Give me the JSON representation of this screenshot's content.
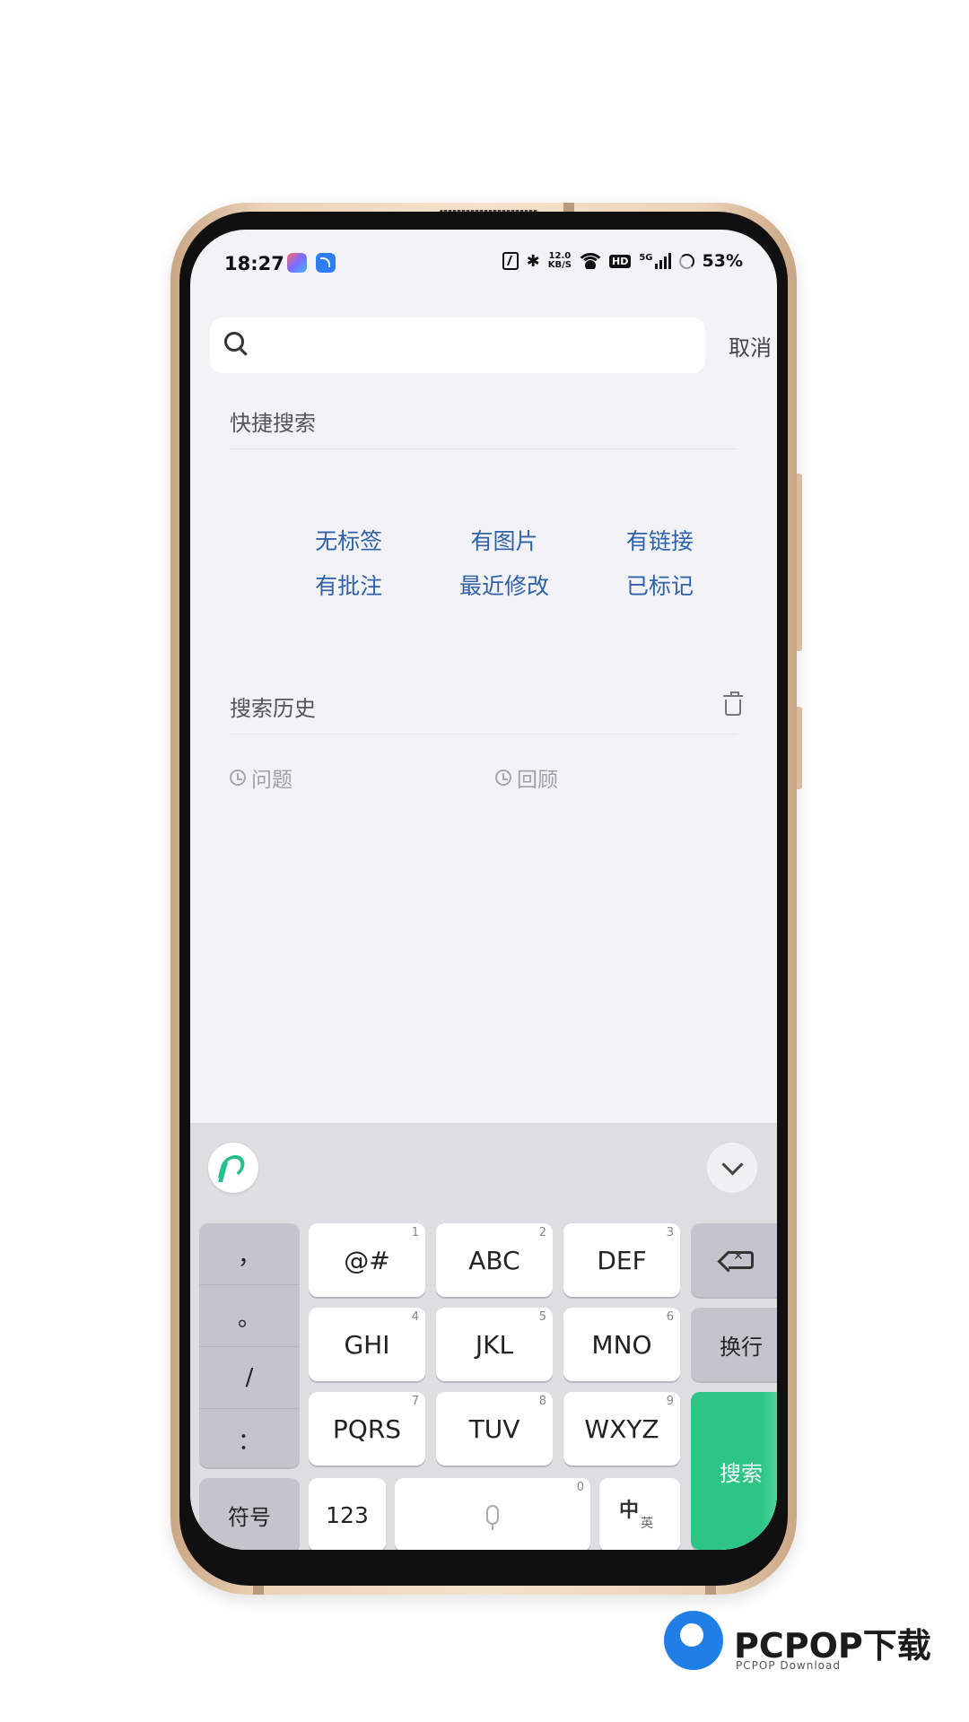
{
  "status_bar": {
    "time": "18:27",
    "network_speed_top": "12.0",
    "network_speed_unit": "KB/S",
    "hd_label": "HD",
    "signal_label": "5G",
    "battery": "53%"
  },
  "search": {
    "placeholder": "",
    "cancel_label": "取消"
  },
  "quick_search": {
    "title": "快捷搜索",
    "items": [
      "无标签",
      "有图片",
      "有链接",
      "有批注",
      "最近修改",
      "已标记"
    ]
  },
  "history": {
    "title": "搜索历史",
    "items": [
      "问题",
      "回顾"
    ]
  },
  "keyboard": {
    "punctuation": [
      "，",
      "。",
      "/",
      "："
    ],
    "keys": [
      {
        "label": "@#",
        "num": "1"
      },
      {
        "label": "ABC",
        "num": "2"
      },
      {
        "label": "DEF",
        "num": "3"
      },
      {
        "label": "GHI",
        "num": "4"
      },
      {
        "label": "JKL",
        "num": "5"
      },
      {
        "label": "MNO",
        "num": "6"
      },
      {
        "label": "PQRS",
        "num": "7"
      },
      {
        "label": "TUV",
        "num": "8"
      },
      {
        "label": "WXYZ",
        "num": "9"
      }
    ],
    "newline_label": "换行",
    "search_label": "搜索",
    "symbol_label": "符号",
    "numeric_label": "123",
    "space_num": "0",
    "lang_main": "中",
    "lang_sub": "英",
    "accent_color": "#2cc586"
  },
  "watermark": {
    "title": "PCPOP下载",
    "subtitle": "PCPOP Download"
  }
}
